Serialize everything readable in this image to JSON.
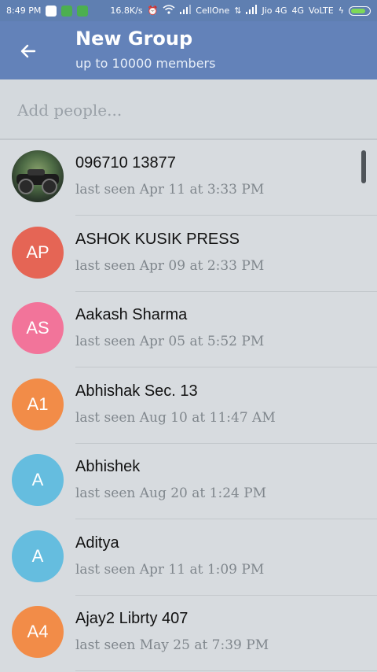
{
  "status_bar": {
    "time": "8:49 PM",
    "net_speed": "16.8K/s",
    "carrier1": "CellOne",
    "carrier2": "Jio 4G",
    "network": "4G",
    "volte": "VoLTE"
  },
  "app_bar": {
    "title": "New Group",
    "subtitle": "up to 10000 members",
    "back_icon": "arrow-left-icon"
  },
  "search": {
    "placeholder": "Add people..."
  },
  "contacts": [
    {
      "initials": "",
      "name": "096710 13877",
      "last_seen": "last seen Apr 11 at 3:33 PM",
      "color": "#3e5e38",
      "photo": true
    },
    {
      "initials": "AP",
      "name": "ASHOK KUSIK PRESS",
      "last_seen": "last seen Apr 09 at 2:33 PM",
      "color": "#e56555"
    },
    {
      "initials": "AS",
      "name": "Aakash Sharma",
      "last_seen": "last seen Apr 05 at 5:52 PM",
      "color": "#f2749a"
    },
    {
      "initials": "A1",
      "name": "Abhishak Sec. 13",
      "last_seen": "last seen Aug 10 at 11:47 AM",
      "color": "#f28c48"
    },
    {
      "initials": "A",
      "name": "Abhishek",
      "last_seen": "last seen Aug 20 at 1:24 PM",
      "color": "#65bddf"
    },
    {
      "initials": "A",
      "name": "Aditya",
      "last_seen": "last seen Apr 11 at 1:09 PM",
      "color": "#65bddf"
    },
    {
      "initials": "A4",
      "name": "Ajay2 Librty 407",
      "last_seen": "last seen May 25 at 7:39 PM",
      "color": "#f28c48"
    }
  ]
}
